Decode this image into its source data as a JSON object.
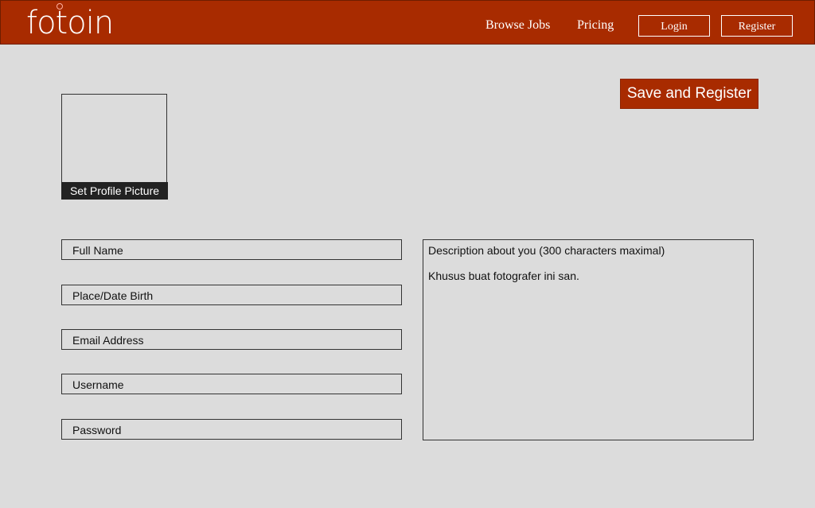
{
  "header": {
    "logo_text": "fotoin",
    "nav": {
      "browse_jobs": "Browse Jobs",
      "pricing": "Pricing",
      "login": "Login",
      "register": "Register"
    }
  },
  "actions": {
    "save_register": "Save and Register"
  },
  "profile": {
    "set_picture_label": "Set Profile Picture"
  },
  "form": {
    "full_name": "Full Name",
    "place_date_birth": "Place/Date Birth",
    "email_address": "Email Address",
    "username": "Username",
    "password": "Password"
  },
  "description": {
    "placeholder": "Description about you (300 characters maximal)",
    "note": "Khusus buat fotografer ini san."
  },
  "colors": {
    "brand": "#a82b00",
    "background": "#dcdcdc",
    "caption_bg": "#222222"
  }
}
